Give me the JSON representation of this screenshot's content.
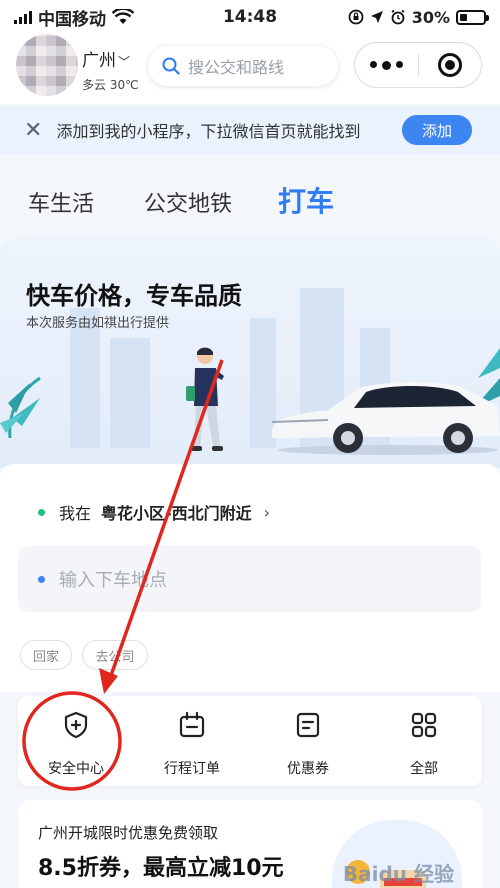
{
  "status_bar": {
    "carrier": "中国移动",
    "time": "14:48",
    "battery": "30%",
    "battery_level": 0.3
  },
  "header": {
    "city": "广州",
    "weather": "多云 30℃",
    "search_placeholder": "搜公交和路线"
  },
  "banner": {
    "text": "添加到我的小程序，下拉微信首页就能找到",
    "button": "添加"
  },
  "tabs": [
    {
      "label": "车生活"
    },
    {
      "label": "公交地铁"
    },
    {
      "label": "打车",
      "active": true
    }
  ],
  "hero": {
    "title": "快车价格，专车品质",
    "subtitle": "本次服务由如祺出行提供"
  },
  "location": {
    "from_prefix": "我在",
    "from_place": "粤花小区-西北门附近",
    "to_placeholder": "输入下车地点",
    "shortcuts": [
      {
        "label": "回家"
      },
      {
        "label": "去公司"
      }
    ]
  },
  "services": [
    {
      "label": "安全中心",
      "icon": "shield-plus-icon"
    },
    {
      "label": "行程订单",
      "icon": "calendar-icon"
    },
    {
      "label": "优惠券",
      "icon": "coupon-icon"
    },
    {
      "label": "全部",
      "icon": "grid-icon"
    }
  ],
  "promo": {
    "title": "广州开城限时优惠免费领取",
    "headline": "8.5折券，最高立减10元",
    "watermark": "Baidu 经验"
  },
  "colors": {
    "accent": "#2f7cf6",
    "button": "#3d86f1",
    "annotation": "#e0261f",
    "origin_dot": "#22c07a"
  }
}
